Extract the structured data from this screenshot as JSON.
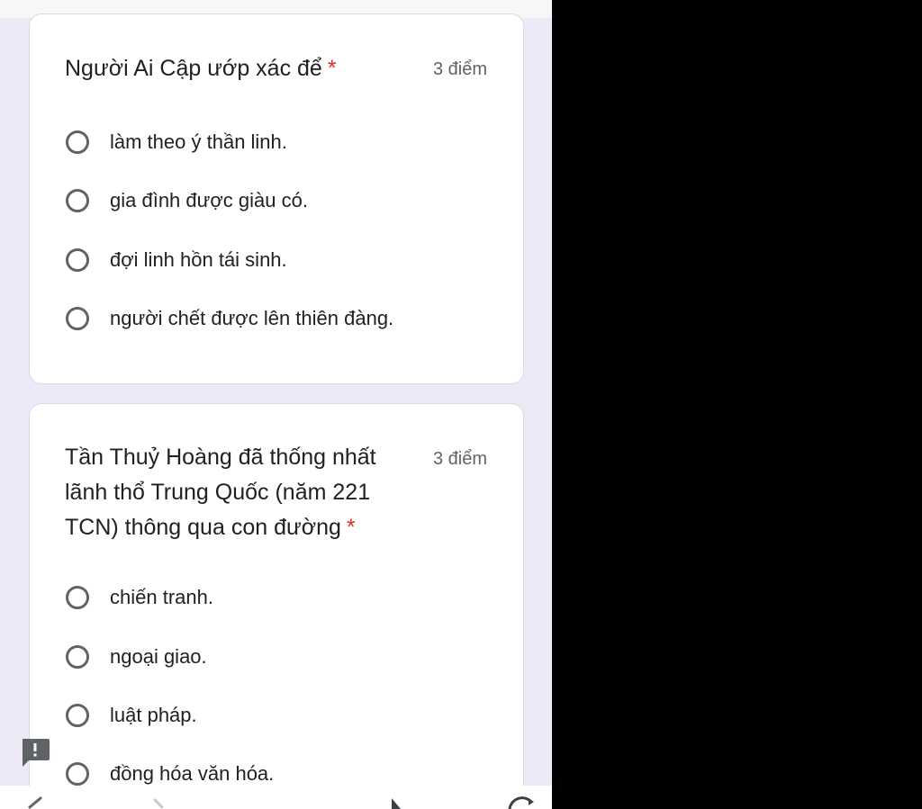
{
  "questions": [
    {
      "title": "Người Ai Cập ướp xác để",
      "required_mark": "*",
      "points": "3 điểm",
      "options": [
        "làm theo ý thần linh.",
        "gia đình được giàu có.",
        "đợi linh hồn tái sinh.",
        "người chết được lên thiên đàng."
      ]
    },
    {
      "title": "Tần Thuỷ Hoàng đã thống nhất lãnh thổ Trung Quốc (năm 221 TCN) thông qua con đường",
      "required_mark": "*",
      "points": "3 điểm",
      "options": [
        "chiến tranh.",
        "ngoại giao.",
        "luật pháp.",
        "đồng hóa văn hóa."
      ]
    }
  ],
  "colors": {
    "page_background": "#ede9f7",
    "card_background": "#ffffff",
    "required": "#d93025",
    "text": "#202124",
    "secondary_text": "#5f6368"
  },
  "icons": {
    "report": "report-problem-icon",
    "nav_back": "back-icon",
    "nav_forward": "forward-icon",
    "nav_share": "share-icon",
    "nav_reload": "reload-icon"
  }
}
